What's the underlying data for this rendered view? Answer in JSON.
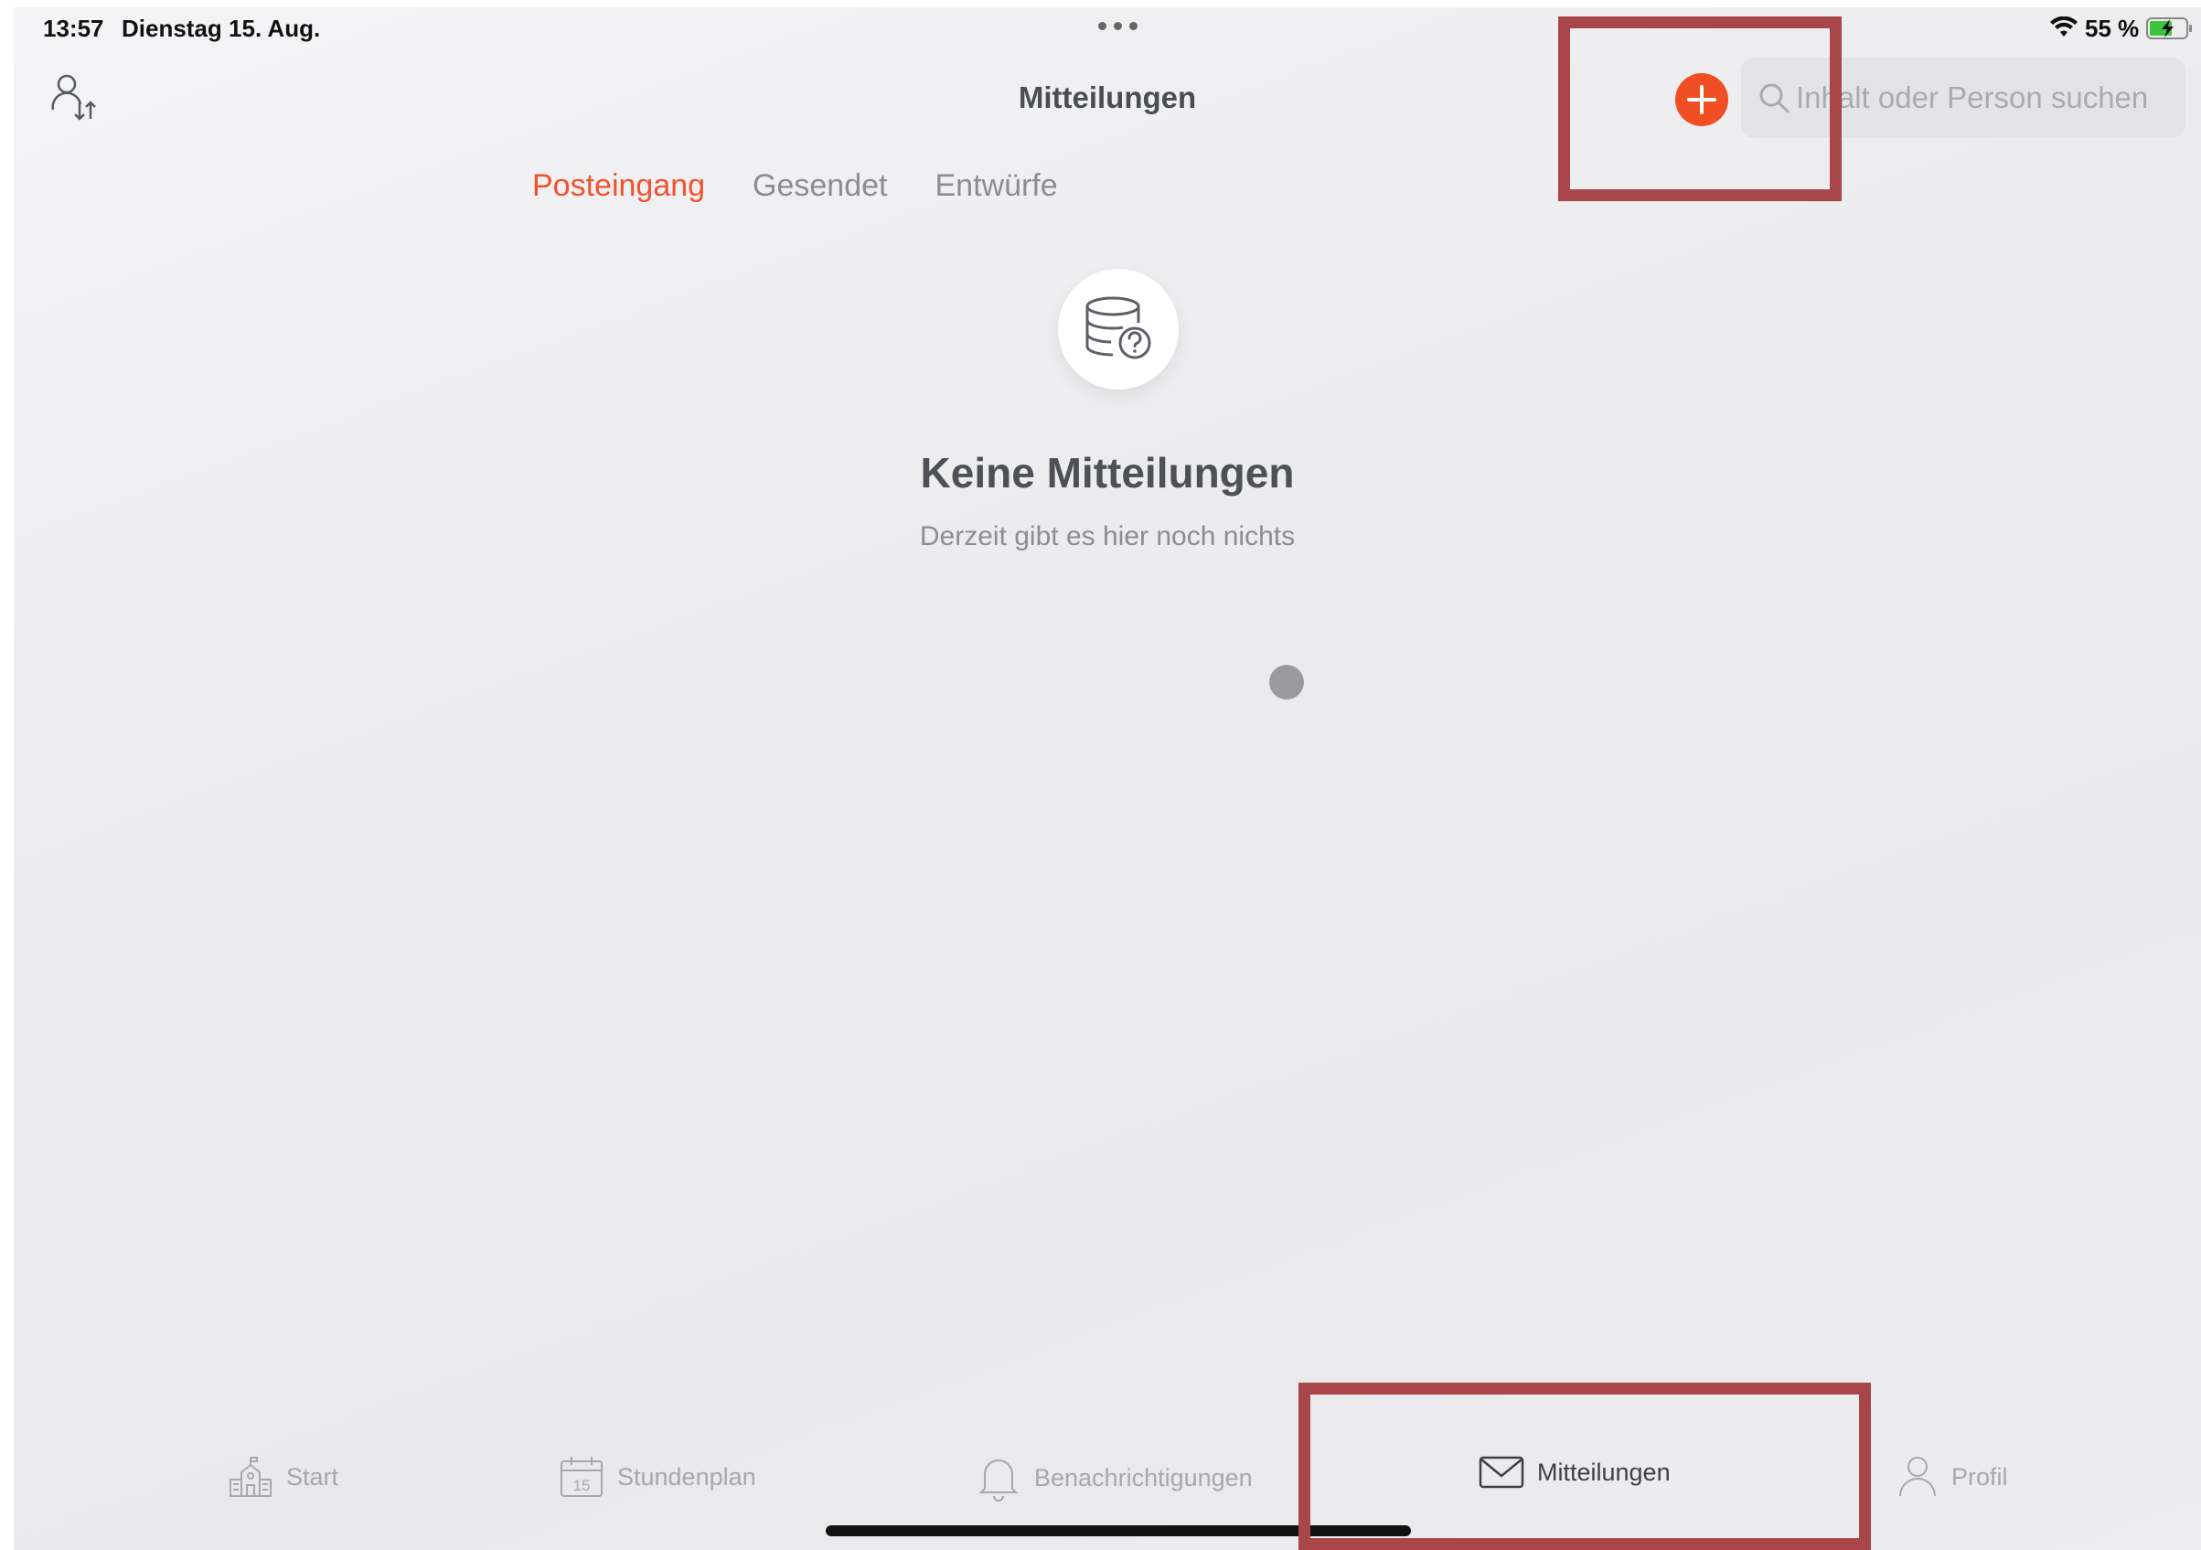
{
  "status_bar": {
    "time": "13:57",
    "date": "Dienstag 15. Aug.",
    "battery": "55 %"
  },
  "header": {
    "title": "Mitteilungen",
    "search_placeholder": "Inhalt oder Person suchen"
  },
  "tabs": [
    {
      "label": "Posteingang",
      "active": true
    },
    {
      "label": "Gesendet",
      "active": false
    },
    {
      "label": "Entwürfe",
      "active": false
    }
  ],
  "empty_state": {
    "icon": "database-question-icon",
    "title": "Keine Mitteilungen",
    "subtitle": "Derzeit gibt es hier noch nichts"
  },
  "tab_bar": [
    {
      "label": "Start",
      "icon": "school-icon",
      "active": false
    },
    {
      "label": "Stundenplan",
      "icon": "calendar-icon",
      "calendar_day": "15",
      "active": false
    },
    {
      "label": "Benachrichtigungen",
      "icon": "bell-icon",
      "active": false
    },
    {
      "label": "Mitteilungen",
      "icon": "mail-icon",
      "active": true
    },
    {
      "label": "Profil",
      "icon": "person-icon",
      "active": false
    }
  ],
  "colors": {
    "accent": "#f04e23",
    "highlight_box": "#a8464a",
    "text_primary": "#4a4d52",
    "text_secondary": "#8a8d93"
  }
}
